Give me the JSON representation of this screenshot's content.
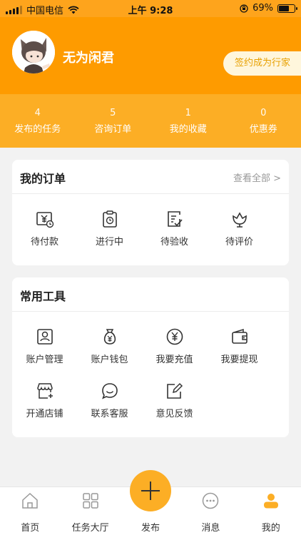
{
  "status_bar": {
    "carrier": "中国电信",
    "time": "上午 9:28",
    "battery": "69%",
    "battery_level": 0.69
  },
  "profile": {
    "name": "无为闲君",
    "sign_button": "签约成为行家"
  },
  "stats": [
    {
      "count": "4",
      "label": "发布的任务"
    },
    {
      "count": "5",
      "label": "咨询订单"
    },
    {
      "count": "1",
      "label": "我的收藏"
    },
    {
      "count": "0",
      "label": "优惠券"
    }
  ],
  "orders": {
    "title": "我的订单",
    "view_all": "查看全部 >",
    "items": [
      {
        "label": "待付款",
        "icon": "payment-pending-icon"
      },
      {
        "label": "进行中",
        "icon": "in-progress-icon"
      },
      {
        "label": "待验收",
        "icon": "acceptance-icon"
      },
      {
        "label": "待评价",
        "icon": "review-icon"
      }
    ]
  },
  "tools": {
    "title": "常用工具",
    "items": [
      {
        "label": "账户管理",
        "icon": "account-icon"
      },
      {
        "label": "账户钱包",
        "icon": "money-bag-icon"
      },
      {
        "label": "我要充值",
        "icon": "yen-circle-icon"
      },
      {
        "label": "我要提现",
        "icon": "wallet-icon"
      },
      {
        "label": "开通店铺",
        "icon": "store-icon"
      },
      {
        "label": "联系客服",
        "icon": "chat-icon"
      },
      {
        "label": "意见反馈",
        "icon": "feedback-icon"
      }
    ]
  },
  "tabbar": {
    "items": [
      {
        "label": "首页",
        "icon": "home-icon"
      },
      {
        "label": "任务大厅",
        "icon": "grid-icon"
      },
      {
        "label": "发布",
        "icon": "plus-icon"
      },
      {
        "label": "消息",
        "icon": "message-icon"
      },
      {
        "label": "我的",
        "icon": "profile-icon"
      }
    ],
    "active_color": "#fcae25"
  },
  "colors": {
    "header": "#fe9b00",
    "stats": "#fcae25",
    "sign_text": "#e8a000"
  }
}
